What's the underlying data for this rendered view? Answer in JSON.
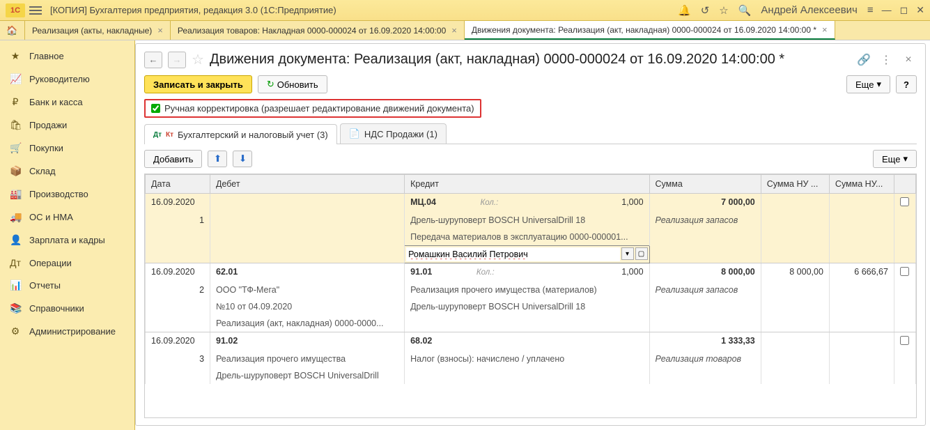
{
  "app": {
    "title": "[КОПИЯ] Бухгалтерия предприятия, редакция 3.0  (1С:Предприятие)",
    "user": "Андрей Алексеевич"
  },
  "tabs": [
    {
      "label": "Реализация (акты, накладные)",
      "active": false
    },
    {
      "label": "Реализация товаров: Накладная 0000-000024 от 16.09.2020 14:00:00",
      "active": false
    },
    {
      "label": "Движения документа: Реализация (акт, накладная) 0000-000024 от 16.09.2020 14:00:00 *",
      "active": true
    }
  ],
  "sidebar": [
    {
      "icon": "★",
      "label": "Главное"
    },
    {
      "icon": "📈",
      "label": "Руководителю"
    },
    {
      "icon": "₽",
      "label": "Банк и касса"
    },
    {
      "icon": "🛍",
      "label": "Продажи"
    },
    {
      "icon": "🛒",
      "label": "Покупки"
    },
    {
      "icon": "📦",
      "label": "Склад"
    },
    {
      "icon": "🏭",
      "label": "Производство"
    },
    {
      "icon": "🚚",
      "label": "ОС и НМА"
    },
    {
      "icon": "👤",
      "label": "Зарплата и кадры"
    },
    {
      "icon": "Дт",
      "label": "Операции"
    },
    {
      "icon": "📊",
      "label": "Отчеты"
    },
    {
      "icon": "📚",
      "label": "Справочники"
    },
    {
      "icon": "⚙",
      "label": "Администрирование"
    }
  ],
  "page": {
    "title": "Движения документа: Реализация (акт, накладная) 0000-000024 от 16.09.2020 14:00:00 *",
    "save_close": "Записать и закрыть",
    "refresh": "Обновить",
    "more": "Еще",
    "help": "?",
    "manual_edit": "Ручная корректировка (разрешает редактирование движений документа)",
    "add": "Добавить"
  },
  "inner_tabs": [
    {
      "label": "Бухгалтерский и налоговый учет (3)",
      "active": true
    },
    {
      "label": "НДС Продажи (1)",
      "active": false
    }
  ],
  "columns": {
    "date": "Дата",
    "debit": "Дебет",
    "credit": "Кредит",
    "sum": "Сумма",
    "sum_nu1": "Сумма НУ ...",
    "sum_nu2": "Сумма НУ..."
  },
  "rows": [
    {
      "n": "1",
      "date": "16.09.2020",
      "highlight": true,
      "debit": {
        "acc": "",
        "lines": []
      },
      "credit": {
        "acc": "МЦ.04",
        "kol": "Кол.:",
        "qty": "1,000",
        "lines": [
          "Дрель-шуруповерт BOSCH UniversalDrill 18",
          "Передача материалов в эксплуатацию 0000-000001..."
        ],
        "edit_value": "Ромашкин Василий Петрович"
      },
      "sum": "7 000,00",
      "comment": "Реализация запасов"
    },
    {
      "n": "2",
      "date": "16.09.2020",
      "debit": {
        "acc": "62.01",
        "lines": [
          "ООО \"ТФ-Мега\"",
          "№10 от 04.09.2020",
          "Реализация (акт, накладная) 0000-0000..."
        ]
      },
      "credit": {
        "acc": "91.01",
        "kol": "Кол.:",
        "qty": "1,000",
        "lines": [
          "Реализация прочего имущества (материалов)",
          "Дрель-шуруповерт BOSCH UniversalDrill 18"
        ]
      },
      "sum": "8 000,00",
      "sum_nu1": "8 000,00",
      "sum_nu2": "6 666,67",
      "comment": "Реализация запасов"
    },
    {
      "n": "3",
      "date": "16.09.2020",
      "debit": {
        "acc": "91.02",
        "lines": [
          "Реализация прочего имущества",
          "Дрель-шуруповерт BOSCH UniversalDrill"
        ]
      },
      "credit": {
        "acc": "68.02",
        "lines": [
          "Налог (взносы): начислено / уплачено"
        ]
      },
      "sum": "1 333,33",
      "comment": "Реализация товаров"
    }
  ]
}
